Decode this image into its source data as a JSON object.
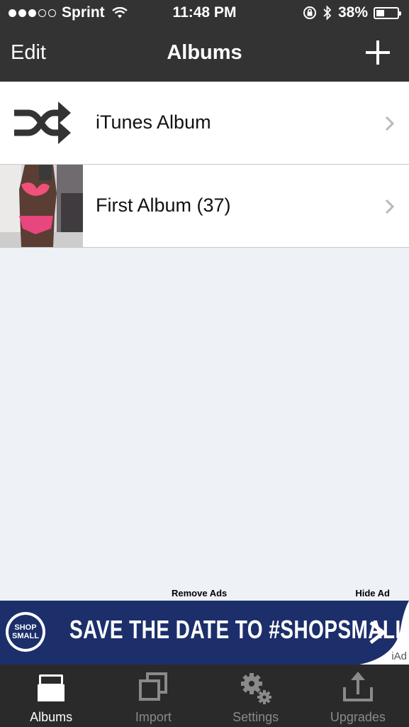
{
  "status_bar": {
    "carrier": "Sprint",
    "time": "11:48 PM",
    "battery_percent": "38%",
    "battery_level": 0.38,
    "signal_bars_filled": 3,
    "signal_bars_total": 5
  },
  "nav": {
    "edit_label": "Edit",
    "title": "Albums"
  },
  "albums": [
    {
      "label": "iTunes Album",
      "icon": "shuffle-icon"
    },
    {
      "label": "First Album (37)",
      "icon": "album-photo-thumbnail"
    }
  ],
  "ad": {
    "remove_ads_label": "Remove Ads",
    "hide_ad_label": "Hide Ad",
    "badge_line1": "SHOP",
    "badge_line2": "SMALL",
    "text": "SAVE THE DATE TO #SHOPSMALL",
    "iad_label": "iAd",
    "colors": {
      "banner": "#1c2f6b"
    }
  },
  "tabs": [
    {
      "label": "Albums",
      "icon": "albums-tray-icon",
      "active": true
    },
    {
      "label": "Import",
      "icon": "import-stack-icon",
      "active": false
    },
    {
      "label": "Settings",
      "icon": "gear-icon",
      "active": false
    },
    {
      "label": "Upgrades",
      "icon": "upload-share-icon",
      "active": false
    }
  ],
  "colors": {
    "bars": "#333333",
    "background": "#eef1f5",
    "tab_active": "#ffffff",
    "tab_inactive": "#8a8a8a"
  }
}
